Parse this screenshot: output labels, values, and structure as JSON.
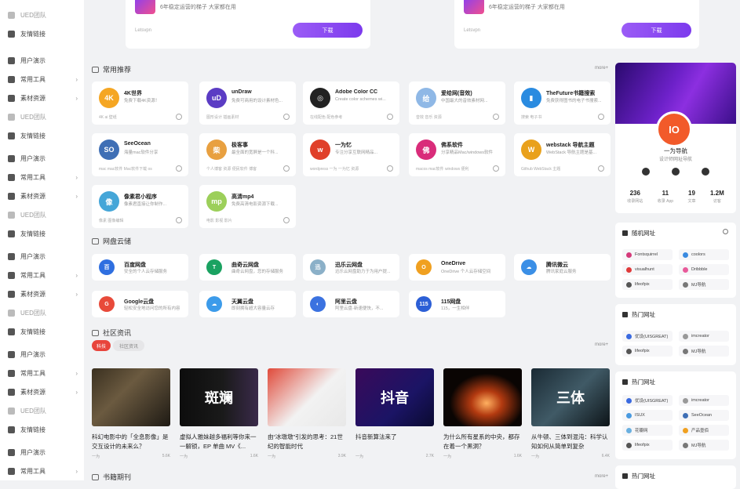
{
  "sidebar": {
    "items": [
      {
        "label": "UED团队",
        "arrow": "",
        "dim": true
      },
      {
        "label": "友情链接",
        "arrow": ""
      },
      {
        "label": "用户演示",
        "arrow": ""
      },
      {
        "label": "常用工具",
        "arrow": "›"
      },
      {
        "label": "素材资源",
        "arrow": "›"
      },
      {
        "label": "UED团队",
        "arrow": "",
        "dim": true
      },
      {
        "label": "友情链接",
        "arrow": ""
      },
      {
        "label": "用户演示",
        "arrow": ""
      },
      {
        "label": "常用工具",
        "arrow": "›"
      },
      {
        "label": "素材资源",
        "arrow": "›"
      },
      {
        "label": "UED团队",
        "arrow": "",
        "dim": true
      },
      {
        "label": "友情链接",
        "arrow": ""
      },
      {
        "label": "用户演示",
        "arrow": ""
      },
      {
        "label": "常用工具",
        "arrow": "›"
      },
      {
        "label": "素材资源",
        "arrow": "›"
      },
      {
        "label": "UED团队",
        "arrow": "",
        "dim": true
      },
      {
        "label": "友情链接",
        "arrow": ""
      },
      {
        "label": "用户演示",
        "arrow": ""
      },
      {
        "label": "常用工具",
        "arrow": "›"
      },
      {
        "label": "素材资源",
        "arrow": "›"
      },
      {
        "label": "UED团队",
        "arrow": "",
        "dim": true
      },
      {
        "label": "友情链接",
        "arrow": ""
      },
      {
        "label": "用户演示",
        "arrow": ""
      },
      {
        "label": "常用工具",
        "arrow": "›"
      }
    ]
  },
  "top_cards": [
    {
      "text": "6年稳定运营的梯子 大家都在用",
      "source": "Letsvpn",
      "button": "下载"
    },
    {
      "text": "6年稳定运营的梯子 大家都在用",
      "source": "Letsvpn",
      "button": "下载"
    }
  ],
  "sections": {
    "common": {
      "title": "常用推荐",
      "more": "more+"
    },
    "cloud": {
      "title": "网盘云储"
    },
    "community": {
      "title": "社区资讯",
      "more": "more+"
    },
    "books": {
      "title": "书籍期刊",
      "more": "more+"
    }
  },
  "common_cards": [
    {
      "title": "4K世界",
      "desc": "免费下载4K资源！",
      "tags": "4K   ai   壁纸",
      "icon": "4K",
      "color": "#f5a623",
      "icon_name": "4k-world-icon"
    },
    {
      "title": "unDraw",
      "desc": "免费可商用的设计素材色...",
      "tags": "图形设计   插画素材",
      "icon": "uD",
      "color": "#5b3cc4",
      "icon_name": "undraw-icon"
    },
    {
      "title": "Adobe Color CC",
      "desc": "Create color schemes wi...",
      "tags": "在线配色   配色参考",
      "icon": "◎",
      "color": "#222",
      "icon_name": "adobe-color-icon"
    },
    {
      "title": "爱给网(音效)",
      "desc": "中国最大的音效素材网...",
      "tags": "音效   音乐   资源",
      "icon": "给",
      "color": "#8fb8e6",
      "icon_name": "aigei-icon"
    },
    {
      "title": "TheFuture书籍搜索",
      "desc": "免费获得图书的电子书搜索...",
      "tags": "搜索   电子书",
      "icon": "▮",
      "color": "#2a8be0",
      "icon_name": "thefuture-icon"
    },
    {
      "title": "SeeOcean",
      "desc": "海量mac软件分享",
      "tags": "mac   mac软件   Mac软件下载   os",
      "icon": "SO",
      "color": "#3f6fb5",
      "icon_name": "seeocean-icon"
    },
    {
      "title": "极客事",
      "desc": "最全面的宽屏是一个科...",
      "tags": "个人博客   资源   便民软件   博客",
      "icon": "柴",
      "color": "#e8a040",
      "icon_name": "jikeshi-icon"
    },
    {
      "title": "一为忆",
      "desc": "专注分享互联网精品...",
      "tags": "wordpress   一为   一为忆   资源",
      "icon": "w",
      "color": "#e0402a",
      "icon_name": "yiweiyi-icon"
    },
    {
      "title": "佛系软件",
      "desc": "分享精品Mac/windows软件",
      "tags": "macos   mac软件   windows   便利",
      "icon": "佛",
      "color": "#d92c7a",
      "icon_name": "foxi-icon"
    },
    {
      "title": "webstack 导航主题",
      "desc": "WebStack 导航主题是基...",
      "tags": "Github   WebStack   主题",
      "icon": "W",
      "color": "#e9a11c",
      "icon_name": "webstack-icon"
    },
    {
      "title": "像素君小程序",
      "desc": "像素君直接让你制作...",
      "tags": "像素   图像编辑",
      "icon": "像",
      "color": "#45a6d8",
      "icon_name": "xiangsujun-icon"
    },
    {
      "title": "高清mp4",
      "desc": "免费高清电影资源下载...",
      "tags": "电影   影视   影片",
      "icon": "mp",
      "color": "#9ccf5a",
      "icon_name": "gaoqing-mp4-icon"
    }
  ],
  "cloud_cards": [
    {
      "title": "百度网盘",
      "desc": "安全的个人云存储服务",
      "icon": "百",
      "color": "#2f6fe0",
      "icon_name": "baidu-pan-icon"
    },
    {
      "title": "曲奇云网盘",
      "desc": "曲奇云网盘，您的存储服务",
      "icon": "T",
      "color": "#1aa261",
      "icon_name": "quqi-icon"
    },
    {
      "title": "迅乐云网盘",
      "desc": "迅乐云网盘助力于为用户提...",
      "icon": "迅",
      "color": "#8bb0c8",
      "icon_name": "xunle-icon"
    },
    {
      "title": "OneDrive",
      "desc": "OneDrive 个人云存储空间",
      "icon": "O",
      "color": "#f0a020",
      "icon_name": "onedrive-icon"
    },
    {
      "title": "腾讯微云",
      "desc": "腾讯家庭云服务",
      "icon": "☁",
      "color": "#3b8fe6",
      "icon_name": "weiyun-icon"
    },
    {
      "title": "Google云盘",
      "desc": "轻松安全地访问您的所有内容",
      "icon": "G",
      "color": "#e84a3a",
      "icon_name": "google-drive-icon"
    },
    {
      "title": "天翼云盘",
      "desc": "即刻拥有超大容量云存",
      "icon": "☁",
      "color": "#3c9bea",
      "icon_name": "tianyi-icon"
    },
    {
      "title": "阿里云盘",
      "desc": "阿里云盘-新速便快，不...",
      "icon": "◐",
      "color": "#3b72e0",
      "icon_name": "aliyun-pan-icon"
    },
    {
      "title": "115网盘",
      "desc": "115，一生相伴",
      "icon": "115",
      "color": "#2c5fd6",
      "icon_name": "pan115-icon"
    }
  ],
  "community_tabs": [
    {
      "label": "科技",
      "active": true
    },
    {
      "label": "社区资讯",
      "active": false
    }
  ],
  "news": [
    {
      "title": "科幻电影中的「全息影像」是交互设计的未来么？",
      "author": "一为",
      "views": "5.6K",
      "bg": "linear-gradient(135deg,#3a3020,#6b5a40 40%,#1e1a14)",
      "overlay": ""
    },
    {
      "title": "虚拟人雅妹越多福利等你来一一解锁，EP 单曲 MV《...",
      "author": "一为",
      "views": "1.6K",
      "bg": "linear-gradient(90deg,#0d0d0d,#1a1a1a 55%,#3a2a4a)",
      "overlay": "斑斓"
    },
    {
      "title": "由“冰墩墩”引发的思考：21世纪的智能时代",
      "author": "一为",
      "views": "3.9K",
      "bg": "linear-gradient(135deg,#e04a3a,#f2f2f2 55%,#e8e8e8)",
      "overlay": ""
    },
    {
      "title": "抖音新算法来了",
      "author": "一为",
      "views": "2.7K",
      "bg": "linear-gradient(135deg,#3a0a5a,#1b1465 60%,#0a0a30)",
      "overlay": "抖音"
    },
    {
      "title": "为什么所有星系的中央，都存在着一个黑洞？",
      "author": "一为",
      "views": "1.6K",
      "bg": "radial-gradient(ellipse at 55% 60%,#ffb060 0%,#b33a10 25%,#0a0503 60%)",
      "overlay": ""
    },
    {
      "title": "从牛顿、三体到混沌：科学认知如何从简单到复杂",
      "author": "一为",
      "views": "6.4K",
      "bg": "linear-gradient(135deg,#1a2a34,#405a66 50%,#0d1418)",
      "overlay": "三体"
    }
  ],
  "profile": {
    "avatar_text": "IO",
    "name": "一为导航",
    "subtitle": "设计师网址导航",
    "stats": [
      {
        "value": "236",
        "label": "收录网站"
      },
      {
        "value": "11",
        "label": "收录 App"
      },
      {
        "value": "19",
        "label": "文章"
      },
      {
        "value": "1.2M",
        "label": "访客"
      }
    ]
  },
  "random_sites": {
    "title": "随机网址",
    "chips": [
      {
        "label": "Fontsquirrel",
        "color": "#d43a7a"
      },
      {
        "label": "coolors",
        "color": "#3a8ae0"
      },
      {
        "label": "visualhunt",
        "color": "#e03a3a"
      },
      {
        "label": "Dribbble",
        "color": "#e85a9a"
      },
      {
        "label": "lifeofpix",
        "color": "#555"
      },
      {
        "label": "MJ导航",
        "color": "#777"
      }
    ]
  },
  "hot_sites_1": {
    "title": "热门网址",
    "chips": [
      {
        "label": "优设(UISGREAT)",
        "color": "#3a6ae0"
      },
      {
        "label": "imcreator",
        "color": "#999"
      },
      {
        "label": "lifeofpix",
        "color": "#555"
      },
      {
        "label": "MJ导航",
        "color": "#777"
      }
    ]
  },
  "hot_sites_2": {
    "title": "热门网址",
    "chips": [
      {
        "label": "优设(UISGREAT)",
        "color": "#3a6ae0"
      },
      {
        "label": "imcreator",
        "color": "#999"
      },
      {
        "label": "ISUX",
        "color": "#4a9ae0"
      },
      {
        "label": "SeeOcean",
        "color": "#3f6fb5"
      },
      {
        "label": "花瓣网",
        "color": "#6ab0e0"
      },
      {
        "label": "产品壹佰",
        "color": "#f0a020"
      },
      {
        "label": "lifeofpix",
        "color": "#555"
      },
      {
        "label": "MJ导航",
        "color": "#777"
      }
    ]
  },
  "hot_sites_3": {
    "title": "热门网址"
  }
}
